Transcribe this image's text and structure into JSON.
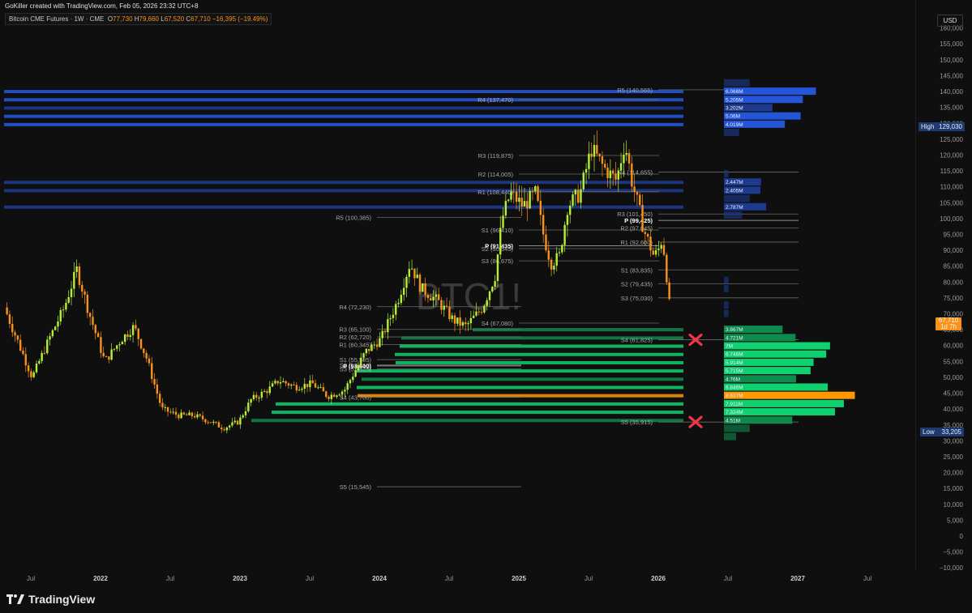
{
  "header": {
    "credit": "GoKiller created with TradingView.com, Feb 05, 2026 23:32 UTC+8",
    "symbol": "Bitcoin CME Futures · 1W · CME",
    "o_label": "O",
    "o": "77,730",
    "h_label": "H",
    "h": "79,660",
    "l_label": "L",
    "l": "67,520",
    "c_label": "C",
    "c": "67,710",
    "change": "−16,395 (−19.49%)"
  },
  "watermark": "BTC1!",
  "currency": "USD",
  "high_tag": {
    "label": "High",
    "value": "129,030"
  },
  "low_tag": {
    "label": "Low",
    "value": "33,205"
  },
  "last_tag": {
    "value": "67,710",
    "countdown": "1d 7h"
  },
  "footer": {
    "brand": "TradingView"
  },
  "colors": {
    "up": "#b5f035",
    "down": "#f7931a",
    "vp_blue": "#2455d8",
    "vp_green": "#10c86a",
    "poc": "#ff9800",
    "marker": "#f23645"
  },
  "chart_data": {
    "type": "candlestick",
    "title": "Bitcoin CME Futures · 1W · CME",
    "ylim": [
      -10000,
      160000
    ],
    "y_ticks": [
      "160,000",
      "155,000",
      "150,000",
      "145,000",
      "140,000",
      "135,000",
      "130,000",
      "125,000",
      "120,000",
      "115,000",
      "110,000",
      "105,000",
      "100,000",
      "95,000",
      "90,000",
      "85,000",
      "80,000",
      "75,000",
      "70,000",
      "65,000",
      "60,000",
      "55,000",
      "50,000",
      "45,000",
      "40,000",
      "35,000",
      "30,000",
      "25,000",
      "20,000",
      "15,000",
      "10,000",
      "5,000",
      "0",
      "−5,000",
      "−10,000"
    ],
    "x_ticks": [
      {
        "t": 2021.5,
        "label": "Jul"
      },
      {
        "t": 2022.0,
        "label": "2022"
      },
      {
        "t": 2022.5,
        "label": "Jul"
      },
      {
        "t": 2023.0,
        "label": "2023"
      },
      {
        "t": 2023.5,
        "label": "Jul"
      },
      {
        "t": 2024.0,
        "label": "2024"
      },
      {
        "t": 2024.5,
        "label": "Jul"
      },
      {
        "t": 2025.0,
        "label": "2025"
      },
      {
        "t": 2025.5,
        "label": "Jul"
      },
      {
        "t": 2026.0,
        "label": "2026"
      },
      {
        "t": 2026.5,
        "label": "Jul"
      },
      {
        "t": 2027.0,
        "label": "2027"
      },
      {
        "t": 2027.5,
        "label": "Jul"
      }
    ],
    "price_path": [
      [
        2021.31,
        72000
      ],
      [
        2021.4,
        62000
      ],
      [
        2021.51,
        50000
      ],
      [
        2021.63,
        62000
      ],
      [
        2021.74,
        72000
      ],
      [
        2021.83,
        84000
      ],
      [
        2021.92,
        70000
      ],
      [
        2022.03,
        55000
      ],
      [
        2022.15,
        62000
      ],
      [
        2022.24,
        66000
      ],
      [
        2022.33,
        56000
      ],
      [
        2022.44,
        40000
      ],
      [
        2022.56,
        38000
      ],
      [
        2022.67,
        38000
      ],
      [
        2022.79,
        36000
      ],
      [
        2022.88,
        34000
      ],
      [
        2022.99,
        36000
      ],
      [
        2023.08,
        43000
      ],
      [
        2023.2,
        46000
      ],
      [
        2023.28,
        49000
      ],
      [
        2023.4,
        47000
      ],
      [
        2023.52,
        48000
      ],
      [
        2023.63,
        44000
      ],
      [
        2023.75,
        46000
      ],
      [
        2023.9,
        58000
      ],
      [
        2024.01,
        62000
      ],
      [
        2024.13,
        74000
      ],
      [
        2024.22,
        86000
      ],
      [
        2024.3,
        78000
      ],
      [
        2024.42,
        74000
      ],
      [
        2024.53,
        68000
      ],
      [
        2024.62,
        66000
      ],
      [
        2024.74,
        72000
      ],
      [
        2024.83,
        82000
      ],
      [
        2024.88,
        100000
      ],
      [
        2024.94,
        108000
      ],
      [
        2025.03,
        104000
      ],
      [
        2025.12,
        108000
      ],
      [
        2025.17,
        96000
      ],
      [
        2025.23,
        86000
      ],
      [
        2025.29,
        88000
      ],
      [
        2025.35,
        104000
      ],
      [
        2025.44,
        108000
      ],
      [
        2025.52,
        122000
      ],
      [
        2025.61,
        116000
      ],
      [
        2025.7,
        112000
      ],
      [
        2025.76,
        124000
      ],
      [
        2025.81,
        112000
      ],
      [
        2025.9,
        96000
      ],
      [
        2025.97,
        88000
      ],
      [
        2026.0,
        90000
      ],
      [
        2026.03,
        94000
      ],
      [
        2026.06,
        82000
      ],
      [
        2026.09,
        67710
      ]
    ],
    "pivot_sets": [
      {
        "levels": [
          {
            "label": "R5 (100,385)",
            "price": 100385
          },
          {
            "label": "R4 (72,230)",
            "price": 72230
          },
          {
            "label": "R3 (65,100)",
            "price": 65100
          },
          {
            "label": "R2 (62,720)",
            "price": 62720
          },
          {
            "label": "R1 (60,345)",
            "price": 60345
          },
          {
            "label": "S1 (55,585)",
            "price": 55585
          },
          {
            "label": "S2 (53,910)",
            "price": 53910
          },
          {
            "label": "P (53,600)",
            "price": 53600,
            "pivot": true
          },
          {
            "label": "S3 (52,625)",
            "price": 52625
          },
          {
            "label": "S4 (43,700)",
            "price": 43700
          },
          {
            "label": "S5 (15,545)",
            "price": 15545
          }
        ]
      },
      {
        "levels": [
          {
            "label": "R4 (137,470)",
            "price": 137470
          },
          {
            "label": "R3 (119,875)",
            "price": 119875
          },
          {
            "label": "R2 (114,005)",
            "price": 114005
          },
          {
            "label": "R1 (108,440)",
            "price": 108440
          },
          {
            "label": "S1 (96,410)",
            "price": 96410
          },
          {
            "label": "P (91,435)",
            "price": 91435,
            "pivot": true
          },
          {
            "label": "S2 (90,545)",
            "price": 90545
          },
          {
            "label": "S3 (86,675)",
            "price": 86675
          },
          {
            "label": "S4 (67,080)",
            "price": 67080
          }
        ]
      },
      {
        "levels": [
          {
            "label": "R5 (140,565)",
            "price": 140565
          },
          {
            "label": "R4 (114,655)",
            "price": 114655
          },
          {
            "label": "R3 (101,450)",
            "price": 101450
          },
          {
            "label": "P (99,425)",
            "price": 99425,
            "pivot": true
          },
          {
            "label": "R2 (97,045)",
            "price": 97045
          },
          {
            "label": "R1 (92,600)",
            "price": 92600
          },
          {
            "label": "S1 (83,835)",
            "price": 83835
          },
          {
            "label": "S2 (79,435)",
            "price": 79435
          },
          {
            "label": "S3 (75,030)",
            "price": 75030
          },
          {
            "label": "S4 (61,825)",
            "price": 61825
          },
          {
            "label": "S5 (35,915)",
            "price": 35915
          }
        ]
      }
    ],
    "volume_profile": [
      {
        "price": 142600,
        "vol": 1.7,
        "group": "blue"
      },
      {
        "price": 140000,
        "vol": 6.066,
        "label": "6.066M",
        "group": "blue"
      },
      {
        "price": 137400,
        "vol": 5.205,
        "label": "5.205M",
        "group": "blue"
      },
      {
        "price": 134800,
        "vol": 3.202,
        "label": "3.202M",
        "group": "blue"
      },
      {
        "price": 132200,
        "vol": 5.06,
        "label": "5.06M",
        "group": "blue"
      },
      {
        "price": 129600,
        "vol": 4.019,
        "label": "4.019M",
        "group": "blue"
      },
      {
        "price": 127000,
        "vol": 1.0,
        "group": "blue"
      },
      {
        "price": 114000,
        "vol": 0.3,
        "group": "blue"
      },
      {
        "price": 111400,
        "vol": 2.447,
        "label": "2.447M",
        "group": "blue"
      },
      {
        "price": 108800,
        "vol": 2.405,
        "label": "2.405M",
        "group": "blue"
      },
      {
        "price": 106200,
        "vol": 1.7,
        "group": "blue"
      },
      {
        "price": 103600,
        "vol": 2.787,
        "label": "2.787M",
        "group": "blue"
      },
      {
        "price": 101000,
        "vol": 1.2,
        "group": "blue"
      },
      {
        "price": 80400,
        "vol": 0.3,
        "group": "blue"
      },
      {
        "price": 77800,
        "vol": 0.3,
        "group": "blue"
      },
      {
        "price": 72600,
        "vol": 0.3,
        "group": "blue"
      },
      {
        "price": 70000,
        "vol": 0.3,
        "group": "blue"
      },
      {
        "price": 65000,
        "vol": 3.867,
        "label": "3.867M",
        "group": "green"
      },
      {
        "price": 62400,
        "vol": 4.721,
        "label": "4.721M",
        "group": "green"
      },
      {
        "price": 59800,
        "vol": 7.0,
        "label": "7M",
        "group": "green"
      },
      {
        "price": 57200,
        "vol": 6.746,
        "label": "6.746M",
        "group": "green"
      },
      {
        "price": 54600,
        "vol": 5.914,
        "label": "5.914M",
        "group": "green"
      },
      {
        "price": 52000,
        "vol": 5.715,
        "label": "5.715M",
        "group": "green"
      },
      {
        "price": 49400,
        "vol": 4.76,
        "label": "4.76M",
        "group": "green"
      },
      {
        "price": 46800,
        "vol": 6.846,
        "label": "6.846M",
        "group": "green"
      },
      {
        "price": 44200,
        "vol": 8.637,
        "label": "8.637M",
        "group": "poc"
      },
      {
        "price": 41600,
        "vol": 7.911,
        "label": "7.911M",
        "group": "green"
      },
      {
        "price": 39000,
        "vol": 7.324,
        "label": "7.324M",
        "group": "green"
      },
      {
        "price": 36400,
        "vol": 4.51,
        "label": "4.51M",
        "group": "green"
      },
      {
        "price": 33800,
        "vol": 1.7,
        "group": "green"
      },
      {
        "price": 31200,
        "vol": 0.8,
        "group": "green"
      }
    ],
    "markers": [
      {
        "price": 61825,
        "symbol": "x"
      },
      {
        "price": 35915,
        "symbol": "x"
      }
    ]
  }
}
